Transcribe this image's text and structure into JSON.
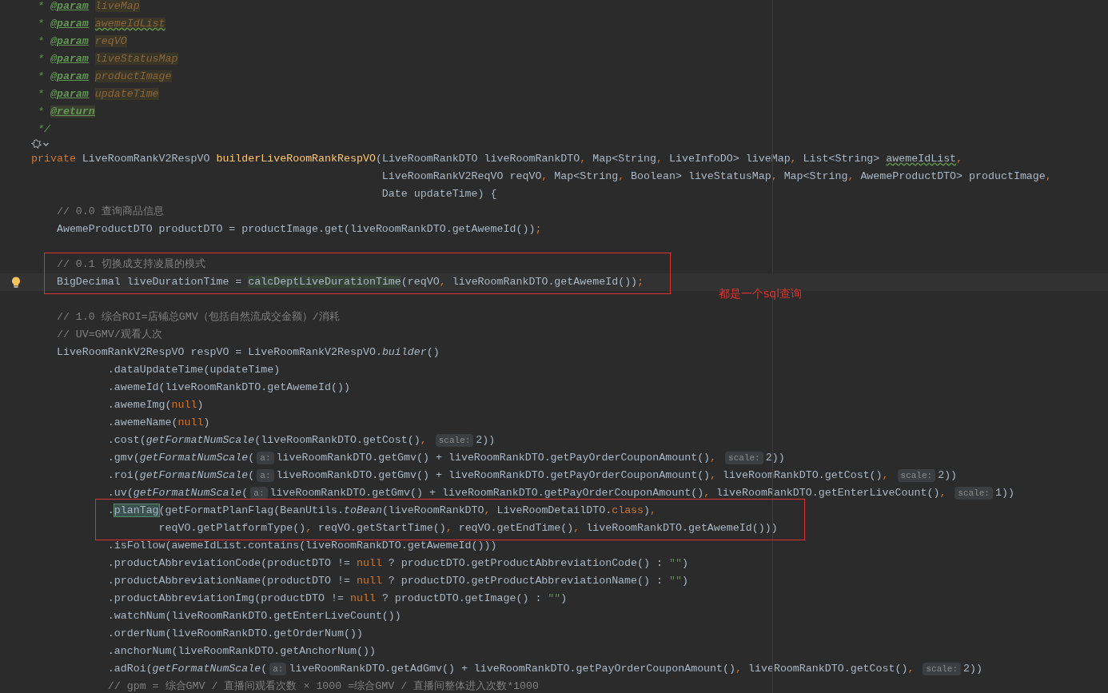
{
  "editor": {
    "lines": [
      {
        "kind": "code",
        "current": false,
        "tokens": [
          {
            "t": " *",
            "kind": "doc"
          },
          {
            "t": "@param",
            "kind": "tag"
          },
          {
            "t": "liveMap",
            "kind": "param"
          }
        ]
      },
      {
        "kind": "code",
        "current": false,
        "tokens": [
          {
            "t": " *",
            "kind": "doc"
          },
          {
            "t": "@param",
            "kind": "tag"
          },
          {
            "t": "awemeIdList",
            "kind": "param-typo"
          }
        ]
      },
      {
        "kind": "code",
        "current": false,
        "tokens": [
          {
            "t": " *",
            "kind": "doc"
          },
          {
            "t": "@param",
            "kind": "tag"
          },
          {
            "t": "reqVO",
            "kind": "param"
          }
        ]
      },
      {
        "kind": "code",
        "current": false,
        "tokens": [
          {
            "t": " *",
            "kind": "doc"
          },
          {
            "t": "@param",
            "kind": "tag"
          },
          {
            "t": "liveStatusMap",
            "kind": "param"
          }
        ]
      },
      {
        "kind": "code",
        "current": false,
        "tokens": [
          {
            "t": " *",
            "kind": "doc"
          },
          {
            "t": "@param",
            "kind": "tag"
          },
          {
            "t": "productImage",
            "kind": "param"
          }
        ]
      },
      {
        "kind": "code",
        "current": false,
        "tokens": [
          {
            "t": " *",
            "kind": "doc"
          },
          {
            "t": "@param",
            "kind": "tag"
          },
          {
            "t": "updateTime",
            "kind": "param"
          }
        ]
      },
      {
        "kind": "code",
        "current": false,
        "tokens": [
          {
            "t": " *",
            "kind": "doc"
          },
          {
            "t": "@return",
            "kind": "tag-hl"
          }
        ]
      },
      {
        "kind": "code",
        "current": false,
        "tokens": [
          {
            "t": " */",
            "kind": "doc"
          }
        ]
      },
      {
        "kind": "icons"
      },
      {
        "kind": "code",
        "current": false,
        "tokens": [
          {
            "t": "private ",
            "kind": "kw"
          },
          {
            "t": "LiveRoomRankV2RespVO ",
            "kind": "plain"
          },
          {
            "t": "builderLiveRoomRankRespVO",
            "kind": "fn"
          },
          {
            "t": "(LiveRoomRankDTO liveRoomRankDTO",
            "kind": "plain"
          },
          {
            "t": ", ",
            "kind": "kw"
          },
          {
            "t": "Map<String",
            "kind": "plain"
          },
          {
            "t": ", ",
            "kind": "kw"
          },
          {
            "t": "LiveInfoDO> liveMap",
            "kind": "plain"
          },
          {
            "t": ", ",
            "kind": "kw"
          },
          {
            "t": "List<String> ",
            "kind": "plain"
          },
          {
            "t": "awemeIdList",
            "kind": "typo"
          },
          {
            "t": ",",
            "kind": "kw"
          }
        ]
      },
      {
        "kind": "code",
        "current": false,
        "tokens": [
          {
            "t": "                                                       LiveRoomRankV2ReqVO reqVO",
            "kind": "plain"
          },
          {
            "t": ", ",
            "kind": "kw"
          },
          {
            "t": "Map<String",
            "kind": "plain"
          },
          {
            "t": ", ",
            "kind": "kw"
          },
          {
            "t": "Boolean> liveStatusMap",
            "kind": "plain"
          },
          {
            "t": ", ",
            "kind": "kw"
          },
          {
            "t": "Map<String",
            "kind": "plain"
          },
          {
            "t": ", ",
            "kind": "kw"
          },
          {
            "t": "AwemeProductDTO> productImage",
            "kind": "plain"
          },
          {
            "t": ",",
            "kind": "kw"
          }
        ]
      },
      {
        "kind": "code",
        "current": false,
        "tokens": [
          {
            "t": "                                                       Date updateTime) {",
            "kind": "plain"
          }
        ]
      },
      {
        "kind": "code",
        "current": false,
        "tokens": [
          {
            "t": "    // 0.0 查询商品信息",
            "kind": "comment"
          }
        ]
      },
      {
        "kind": "code",
        "current": false,
        "tokens": [
          {
            "t": "    AwemeProductDTO productDTO = productImage.get(liveRoomRankDTO.getAwemeId())",
            "kind": "plain"
          },
          {
            "t": ";",
            "kind": "kw"
          }
        ]
      },
      {
        "kind": "blank"
      },
      {
        "kind": "group",
        "boxed": true,
        "note": "都是一个sql查询",
        "lines": [
          {
            "kind": "code",
            "current": false,
            "tokens": [
              {
                "t": "    // 0.1 切换成支持凌晨的模式",
                "kind": "comment"
              }
            ]
          },
          {
            "kind": "code",
            "current": true,
            "tokens": [
              {
                "t": "    BigDecimal liveDurationTime = ",
                "kind": "plain"
              },
              {
                "t": "calcDeptLiveDurationTime",
                "kind": "usage"
              },
              {
                "t": "(reqVO",
                "kind": "plain"
              },
              {
                "t": ", ",
                "kind": "kw"
              },
              {
                "t": "liveRoomRankDTO.getAwemeId())",
                "kind": "plain"
              },
              {
                "t": ";",
                "kind": "kw"
              }
            ]
          }
        ]
      },
      {
        "kind": "blank"
      },
      {
        "kind": "code",
        "current": false,
        "tokens": [
          {
            "t": "    // 1.0 综合ROI=店铺总GMV（包括自然流成交金额）/消耗",
            "kind": "comment"
          }
        ]
      },
      {
        "kind": "code",
        "current": false,
        "tokens": [
          {
            "t": "    // UV=GMV/观看人次",
            "kind": "comment"
          }
        ]
      },
      {
        "kind": "code",
        "current": false,
        "tokens": [
          {
            "t": "    LiveRoomRankV2RespVO respVO = LiveRoomRankV2RespVO.",
            "kind": "plain"
          },
          {
            "t": "builder",
            "kind": "italic"
          },
          {
            "t": "()",
            "kind": "plain"
          }
        ]
      },
      {
        "kind": "code",
        "current": false,
        "tokens": [
          {
            "t": "            .dataUpdateTime(updateTime)",
            "kind": "plain"
          }
        ]
      },
      {
        "kind": "code",
        "current": false,
        "tokens": [
          {
            "t": "            .awemeId(liveRoomRankDTO.getAwemeId())",
            "kind": "plain"
          }
        ]
      },
      {
        "kind": "code",
        "current": false,
        "tokens": [
          {
            "t": "            .awemeImg(",
            "kind": "plain"
          },
          {
            "t": "null",
            "kind": "kw"
          },
          {
            "t": ")",
            "kind": "plain"
          }
        ]
      },
      {
        "kind": "code",
        "current": false,
        "tokens": [
          {
            "t": "            .awemeName(",
            "kind": "plain"
          },
          {
            "t": "null",
            "kind": "kw"
          },
          {
            "t": ")",
            "kind": "plain"
          }
        ]
      },
      {
        "kind": "code",
        "current": false,
        "tokens": [
          {
            "t": "            .cost(",
            "kind": "plain"
          },
          {
            "t": "getFormatNumScale",
            "kind": "italic"
          },
          {
            "t": "(liveRoomRankDTO.getCost()",
            "kind": "plain"
          },
          {
            "t": ", ",
            "kind": "kw"
          },
          {
            "t": "scale:",
            "kind": "hint"
          },
          {
            "t": "2))",
            "kind": "plain"
          }
        ]
      },
      {
        "kind": "code",
        "current": false,
        "tokens": [
          {
            "t": "            .gmv(",
            "kind": "plain"
          },
          {
            "t": "getFormatNumScale",
            "kind": "italic"
          },
          {
            "t": "(",
            "kind": "plain"
          },
          {
            "t": "a:",
            "kind": "hint"
          },
          {
            "t": "liveRoomRankDTO.getGmv() + liveRoomRankDTO.getPayOrderCouponAmount()",
            "kind": "plain"
          },
          {
            "t": ", ",
            "kind": "kw"
          },
          {
            "t": "scale:",
            "kind": "hint"
          },
          {
            "t": "2))",
            "kind": "plain"
          }
        ]
      },
      {
        "kind": "code",
        "current": false,
        "tokens": [
          {
            "t": "            .roi(",
            "kind": "plain"
          },
          {
            "t": "getFormatNumScale",
            "kind": "italic"
          },
          {
            "t": "(",
            "kind": "plain"
          },
          {
            "t": "a:",
            "kind": "hint"
          },
          {
            "t": "liveRoomRankDTO.getGmv() + liveRoomRankDTO.getPayOrderCouponAmount()",
            "kind": "plain"
          },
          {
            "t": ", ",
            "kind": "kw"
          },
          {
            "t": "liveRoomRankDTO.getCost()",
            "kind": "plain"
          },
          {
            "t": ", ",
            "kind": "kw"
          },
          {
            "t": "scale:",
            "kind": "hint"
          },
          {
            "t": "2))",
            "kind": "plain"
          }
        ]
      },
      {
        "kind": "code",
        "current": false,
        "tokens": [
          {
            "t": "            .uv(",
            "kind": "plain"
          },
          {
            "t": "getFormatNumScale",
            "kind": "italic"
          },
          {
            "t": "(",
            "kind": "plain"
          },
          {
            "t": "a:",
            "kind": "hint"
          },
          {
            "t": "liveRoomRankDTO.getGmv() + liveRoomRankDTO.getPayOrderCouponAmount()",
            "kind": "plain"
          },
          {
            "t": ", ",
            "kind": "kw"
          },
          {
            "t": "liveRoomRankDTO.getEnterLiveCount()",
            "kind": "plain"
          },
          {
            "t": ", ",
            "kind": "kw"
          },
          {
            "t": "scale:",
            "kind": "hint"
          },
          {
            "t": "1))",
            "kind": "plain"
          }
        ]
      },
      {
        "kind": "group",
        "boxed": true,
        "lines": [
          {
            "kind": "code",
            "current": false,
            "tokens": [
              {
                "t": "            .",
                "kind": "plain"
              },
              {
                "t": "planTag",
                "kind": "usage-strong"
              },
              {
                "t": "(getFormatPlanFlag(BeanUtils.",
                "kind": "plain"
              },
              {
                "t": "toBean",
                "kind": "italic"
              },
              {
                "t": "(liveRoomRankDTO",
                "kind": "plain"
              },
              {
                "t": ", ",
                "kind": "kw"
              },
              {
                "t": "LiveRoomDetailDTO.",
                "kind": "plain"
              },
              {
                "t": "class",
                "kind": "kw"
              },
              {
                "t": ")",
                "kind": "plain"
              },
              {
                "t": ",",
                "kind": "kw"
              }
            ]
          },
          {
            "kind": "code",
            "current": false,
            "tokens": [
              {
                "t": "                    reqVO.getPlatformType()",
                "kind": "plain"
              },
              {
                "t": ", ",
                "kind": "kw"
              },
              {
                "t": "reqVO.getStartTime()",
                "kind": "plain"
              },
              {
                "t": ", ",
                "kind": "kw"
              },
              {
                "t": "reqVO.getEndTime()",
                "kind": "plain"
              },
              {
                "t": ", ",
                "kind": "kw"
              },
              {
                "t": "liveRoomRankDTO.getAwemeId()))",
                "kind": "plain"
              }
            ]
          }
        ]
      },
      {
        "kind": "code",
        "current": false,
        "tokens": [
          {
            "t": "            .isFollow(awemeIdList.contains(liveRoomRankDTO.getAwemeId()))",
            "kind": "plain"
          }
        ]
      },
      {
        "kind": "code",
        "current": false,
        "tokens": [
          {
            "t": "            .productAbbreviationCode(productDTO != ",
            "kind": "plain"
          },
          {
            "t": "null",
            "kind": "kw"
          },
          {
            "t": " ? productDTO.getProductAbbreviationCode() : ",
            "kind": "plain"
          },
          {
            "t": "\"\"",
            "kind": "str"
          },
          {
            "t": ")",
            "kind": "plain"
          }
        ]
      },
      {
        "kind": "code",
        "current": false,
        "tokens": [
          {
            "t": "            .productAbbreviationName(productDTO != ",
            "kind": "plain"
          },
          {
            "t": "null",
            "kind": "kw"
          },
          {
            "t": " ? productDTO.getProductAbbreviationName() : ",
            "kind": "plain"
          },
          {
            "t": "\"\"",
            "kind": "str"
          },
          {
            "t": ")",
            "kind": "plain"
          }
        ]
      },
      {
        "kind": "code",
        "current": false,
        "tokens": [
          {
            "t": "            .productAbbreviationImg(productDTO != ",
            "kind": "plain"
          },
          {
            "t": "null",
            "kind": "kw"
          },
          {
            "t": " ? productDTO.getImage() : ",
            "kind": "plain"
          },
          {
            "t": "\"\"",
            "kind": "str"
          },
          {
            "t": ")",
            "kind": "plain"
          }
        ]
      },
      {
        "kind": "code",
        "current": false,
        "tokens": [
          {
            "t": "            .watchNum(liveRoomRankDTO.getEnterLiveCount())",
            "kind": "plain"
          }
        ]
      },
      {
        "kind": "code",
        "current": false,
        "tokens": [
          {
            "t": "            .orderNum(liveRoomRankDTO.getOrderNum())",
            "kind": "plain"
          }
        ]
      },
      {
        "kind": "code",
        "current": false,
        "tokens": [
          {
            "t": "            .anchorNum(liveRoomRankDTO.getAnchorNum())",
            "kind": "plain"
          }
        ]
      },
      {
        "kind": "code",
        "current": false,
        "tokens": [
          {
            "t": "            .adRoi(",
            "kind": "plain"
          },
          {
            "t": "getFormatNumScale",
            "kind": "italic"
          },
          {
            "t": "(",
            "kind": "plain"
          },
          {
            "t": "a:",
            "kind": "hint"
          },
          {
            "t": "liveRoomRankDTO.getAdGmv() + liveRoomRankDTO.getPayOrderCouponAmount()",
            "kind": "plain"
          },
          {
            "t": ", ",
            "kind": "kw"
          },
          {
            "t": "liveRoomRankDTO.getCost()",
            "kind": "plain"
          },
          {
            "t": ", ",
            "kind": "kw"
          },
          {
            "t": "scale:",
            "kind": "hint"
          },
          {
            "t": "2))",
            "kind": "plain"
          }
        ]
      },
      {
        "kind": "code",
        "current": false,
        "tokens": [
          {
            "t": "            // gpm = 综合GMV / 直播间观看次数 × 1000 =综合GMV / 直播间整体进入次数*1000",
            "kind": "comment"
          }
        ]
      }
    ]
  }
}
